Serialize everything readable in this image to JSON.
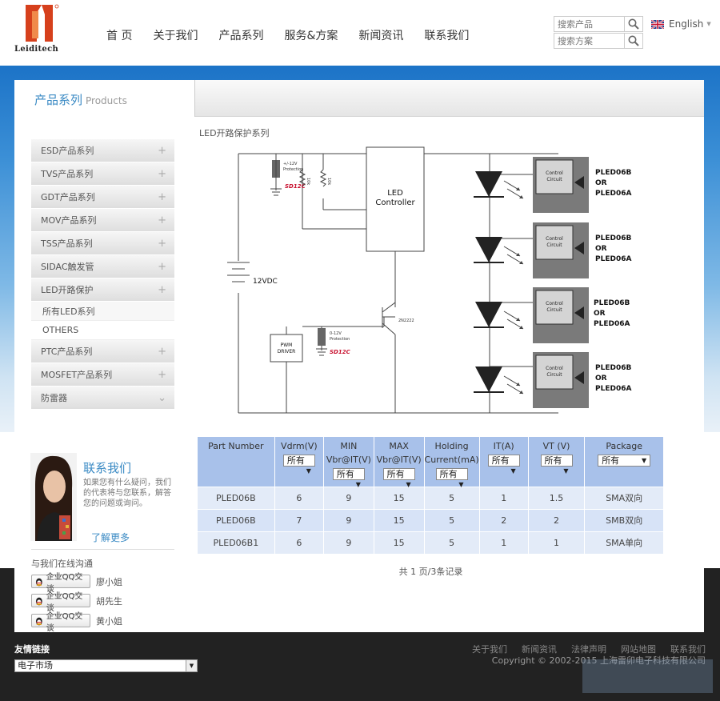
{
  "brand": {
    "name": "Leiditech",
    "logo_icon": "leiditech-logo"
  },
  "nav": {
    "items": [
      "首 页",
      "关于我们",
      "产品系列",
      "服务&方案",
      "新闻资讯",
      "联系我们"
    ]
  },
  "search": {
    "product_placeholder": "搜索产品",
    "solution_placeholder": "搜索方案",
    "icon": "search-icon"
  },
  "language": {
    "label": "English",
    "icon": "uk-flag-icon"
  },
  "panel": {
    "title": "产品系列",
    "title_en": "Products"
  },
  "sidebar": {
    "items": [
      {
        "label": "ESD产品系列",
        "marker": "+"
      },
      {
        "label": "TVS产品系列",
        "marker": "+"
      },
      {
        "label": "GDT产品系列",
        "marker": "+"
      },
      {
        "label": "MOV产品系列",
        "marker": "+"
      },
      {
        "label": "TSS产品系列",
        "marker": "+"
      },
      {
        "label": "SIDAC触发管",
        "marker": "+"
      },
      {
        "label": "LED开路保护",
        "marker": "+"
      }
    ],
    "sub_items": [
      "所有LED系列",
      "OTHERS"
    ],
    "items_after": [
      {
        "label": "PTC产品系列",
        "marker": "+"
      },
      {
        "label": "MOSFET产品系列",
        "marker": "+"
      },
      {
        "label": "防雷器",
        "marker": "⌄"
      }
    ]
  },
  "section": {
    "label": "LED开路保护系列"
  },
  "diagram": {
    "led_controller_line1": "LED",
    "led_controller_line2": "Controller",
    "supply": "12VDC",
    "pwm_line1": "PWM",
    "pwm_line2": "DRIVER",
    "transistor": "2N2222",
    "sd_part": "SD12C",
    "protection_top_line1": "+/-12V",
    "protection_top_line2": "Protection",
    "protection_bot_line1": "0-12V",
    "protection_bot_line2": "Protection",
    "resistor_values": [
      "10k",
      "10k"
    ],
    "control_line1": "Control",
    "control_line2": "Circuit",
    "part_line1": "PLED06B",
    "part_line2": "OR",
    "part_line3": "PLED06A"
  },
  "table": {
    "headers": [
      [
        "Part Number"
      ],
      [
        "Vdrm(V)"
      ],
      [
        "MIN",
        "Vbr@IT(V)"
      ],
      [
        "MAX",
        "Vbr@IT(V)"
      ],
      [
        "Holding",
        "Current(mA)"
      ],
      [
        "IT(A)"
      ],
      [
        "VT (V)"
      ],
      [
        "Package"
      ]
    ],
    "filter_label": "所有",
    "rows": [
      [
        "PLED06B",
        "6",
        "9",
        "15",
        "5",
        "1",
        "1.5",
        "SMA双向"
      ],
      [
        "PLED06B",
        "7",
        "9",
        "15",
        "5",
        "2",
        "2",
        "SMB双向"
      ],
      [
        "PLED06B1",
        "6",
        "9",
        "15",
        "5",
        "1",
        "1",
        "SMA单向"
      ]
    ]
  },
  "pager": {
    "text": "共 1 页/3条记录"
  },
  "contact": {
    "title": "联系我们",
    "text": "如果您有什么疑问，我们的代表将与您联系，解答您的问题或询问。",
    "more": "了解更多",
    "online_label": "与我们在线沟通",
    "qq_label": "企业QQ交谈",
    "agents": [
      "廖小姐",
      "胡先生",
      "黄小姐"
    ]
  },
  "footer": {
    "links_title": "友情链接",
    "select_value": "电子市场",
    "links": [
      "关于我们",
      "新闻资讯",
      "法律声明",
      "网站地图",
      "联系我们"
    ],
    "copyright": "Copyright © 2002-2015 上海雷卯电子科技有限公司"
  }
}
